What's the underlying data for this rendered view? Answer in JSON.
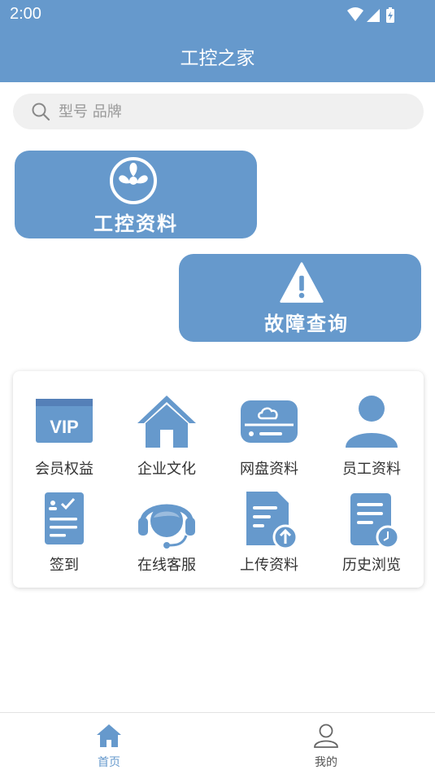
{
  "status_bar": {
    "time": "2:00"
  },
  "header": {
    "title": "工控之家"
  },
  "search": {
    "placeholder": "型号 品牌",
    "value": ""
  },
  "cards": [
    {
      "label": "工控资料",
      "icon": "fan-icon"
    },
    {
      "label": "故障查询",
      "icon": "warning-icon"
    }
  ],
  "grid": {
    "items": [
      {
        "label": "会员权益",
        "icon": "vip-icon"
      },
      {
        "label": "企业文化",
        "icon": "home-icon"
      },
      {
        "label": "网盘资料",
        "icon": "cloud-drive-icon"
      },
      {
        "label": "员工资料",
        "icon": "person-icon"
      },
      {
        "label": "签到",
        "icon": "checklist-icon"
      },
      {
        "label": "在线客服",
        "icon": "headset-icon"
      },
      {
        "label": "上传资料",
        "icon": "upload-doc-icon"
      },
      {
        "label": "历史浏览",
        "icon": "history-doc-icon"
      }
    ]
  },
  "bottom_nav": {
    "items": [
      {
        "label": "首页",
        "icon": "home-icon",
        "active": true
      },
      {
        "label": "我的",
        "icon": "user-icon",
        "active": false
      }
    ]
  },
  "colors": {
    "primary": "#6699cc",
    "text": "#333333",
    "nav_inactive": "#555555"
  }
}
